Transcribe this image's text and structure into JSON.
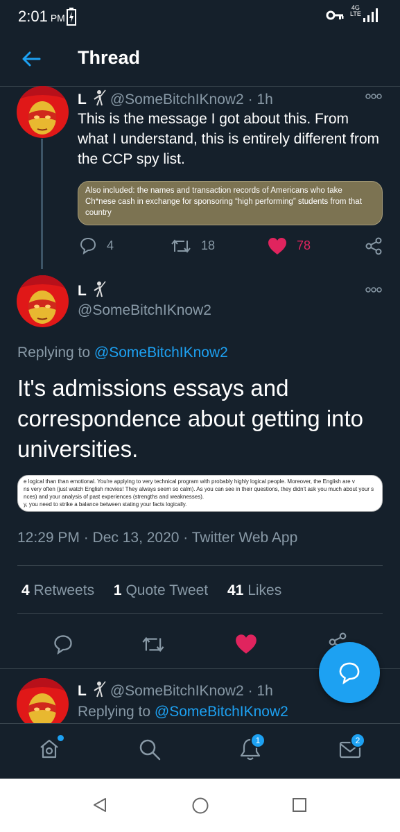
{
  "status_bar": {
    "time": "2:01",
    "ampm": "PM",
    "network": "4G",
    "lte": "LTE"
  },
  "header": {
    "title": "Thread"
  },
  "tweet1": {
    "name": "L",
    "handle": "@SomeBitchIKnow2",
    "time": "· 1h",
    "text": "This is the message I got about this. From what I understand, this is entirely different from the CCP spy list.",
    "image_text": "Also included: the names and transaction records of Americans who take Ch*nese cash in exchange for sponsoring  “high performing” students from that country",
    "reply_count": "4",
    "retweet_count": "18",
    "like_count": "78"
  },
  "main_tweet": {
    "name": "L",
    "handle": "@SomeBitchIKnow2",
    "replying_prefix": "Replying to",
    "replying_handle": "@SomeBitchIKnow2",
    "text": "It's admissions essays and correspondence about getting into universities.",
    "image_lines": [
      "e logical than than emotional.  You're applying to very technical program with probably highly logical people. Moreover, the English are v",
      "ns very often (just watch English movies! They always seem so calm). As you can see in their questions, they didn't ask you much about your s",
      "nces) and your analysis of past experiences (strengths and weaknesses).",
      "y, you need to strike a balance between stating your facts logically."
    ],
    "timestamp": "12:29 PM · Dec 13, 2020 · Twitter Web App",
    "retweets_num": "4",
    "retweets_label": "Retweets",
    "quotes_num": "1",
    "quotes_label": "Quote Tweet",
    "likes_num": "41",
    "likes_label": "Likes"
  },
  "reply_tweet": {
    "name": "L",
    "handle": "@SomeBitchIKnow2",
    "time": "· 1h",
    "replying_prefix": "Replying to",
    "replying_handle": "@SomeBitchIKnow2"
  },
  "bottom_nav": {
    "notifications_badge": "1",
    "messages_badge": "2"
  },
  "colors": {
    "background": "#15202b",
    "accent": "#1da1f2",
    "like": "#e0245e",
    "muted": "#8899a6"
  }
}
